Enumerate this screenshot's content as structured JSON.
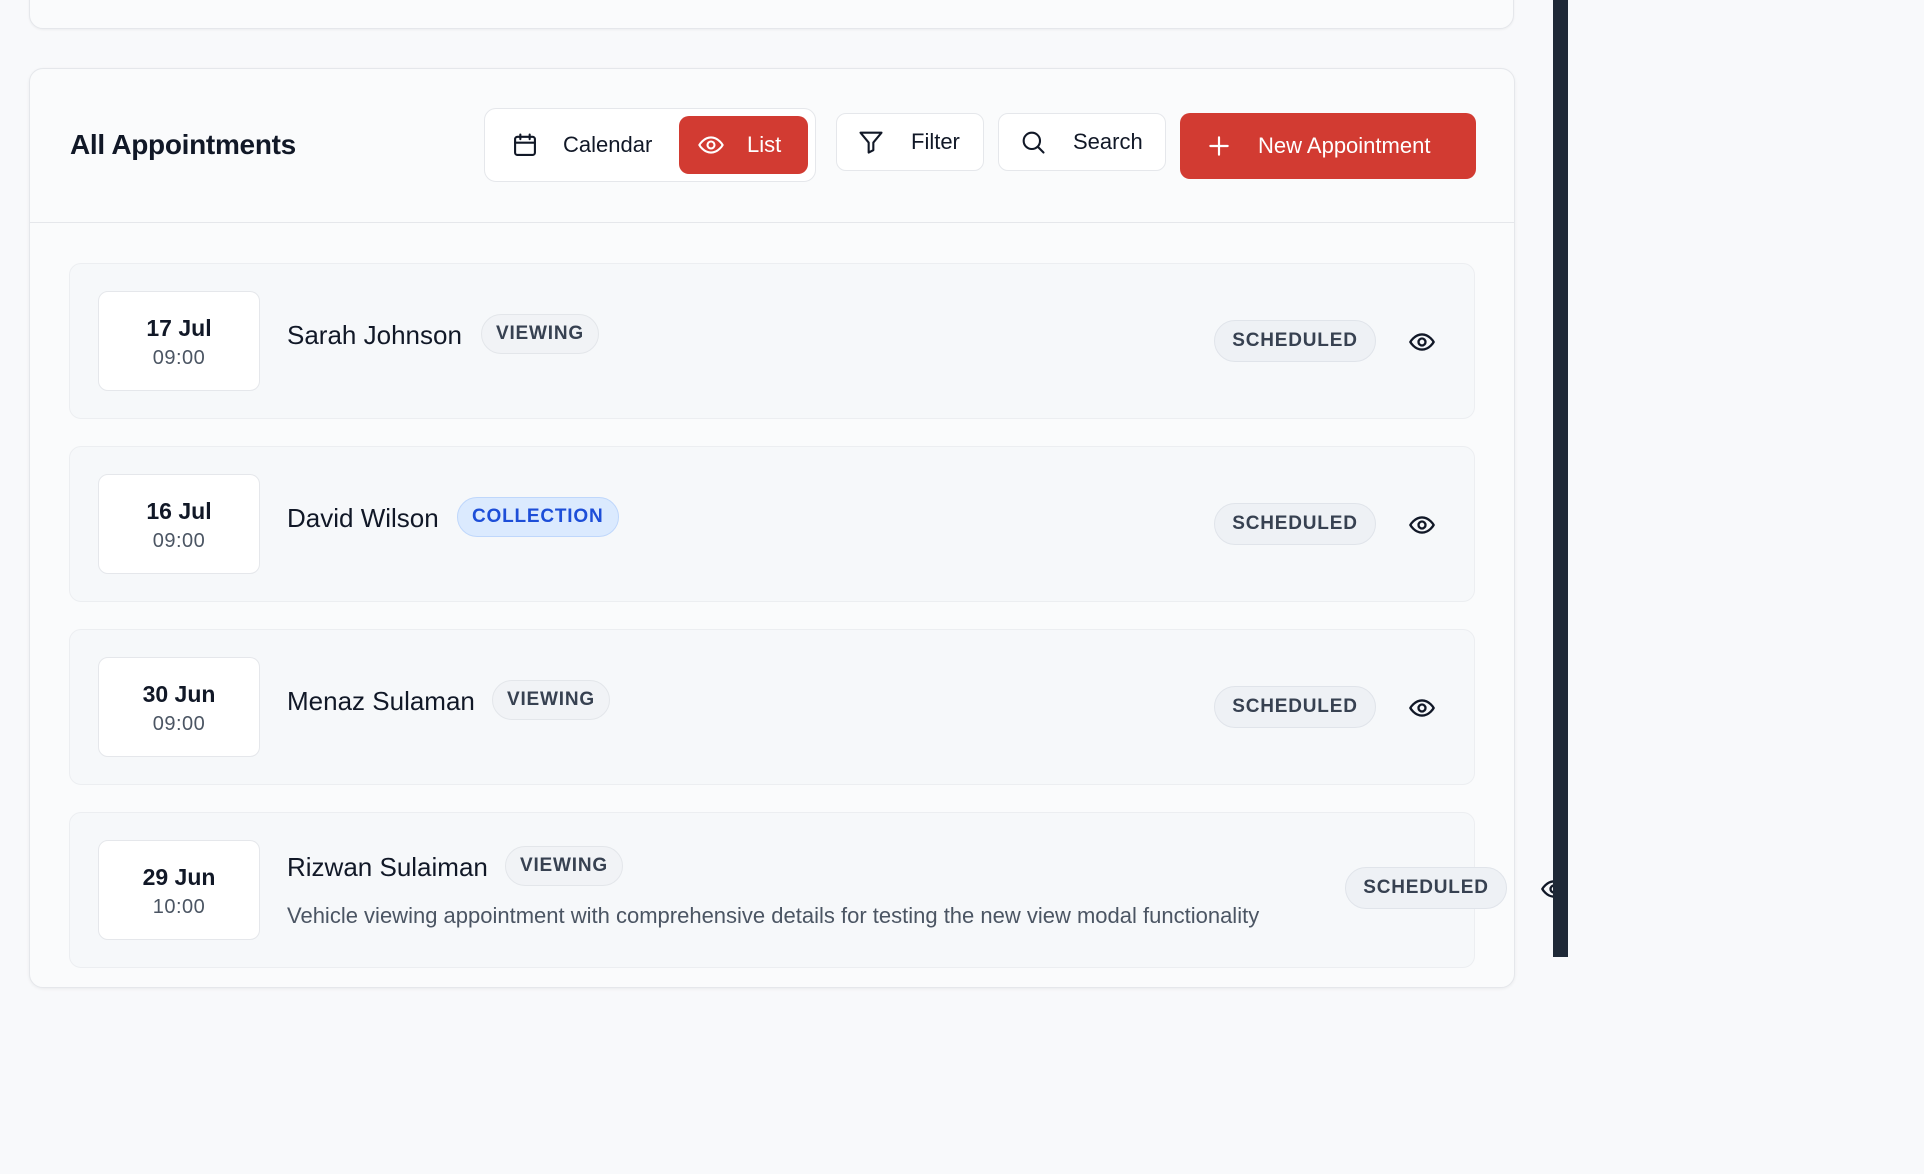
{
  "header": {
    "title": "All Appointments",
    "view_toggle": {
      "calendar_label": "Calendar",
      "list_label": "List",
      "active": "List"
    },
    "filter_label": "Filter",
    "search_label": "Search",
    "new_button_label": "New Appointment"
  },
  "colors": {
    "accent": "#d23b32",
    "collection_badge_text": "#1d4ed8",
    "collection_badge_bg": "#dbeafe"
  },
  "icons": {
    "calendar": "calendar-icon",
    "list": "eye-icon",
    "filter": "funnel-icon",
    "search": "magnifier-icon",
    "new": "plus-icon",
    "view": "eye-icon"
  },
  "appointments": [
    {
      "day": "17 Jul",
      "time": "09:00",
      "name": "Sarah Johnson",
      "type": "VIEWING",
      "status": "SCHEDULED",
      "description": ""
    },
    {
      "day": "16 Jul",
      "time": "09:00",
      "name": "David Wilson",
      "type": "COLLECTION",
      "status": "SCHEDULED",
      "description": ""
    },
    {
      "day": "30 Jun",
      "time": "09:00",
      "name": "Menaz Sulaman",
      "type": "VIEWING",
      "status": "SCHEDULED",
      "description": ""
    },
    {
      "day": "29 Jun",
      "time": "10:00",
      "name": "Rizwan Sulaiman",
      "type": "VIEWING",
      "status": "SCHEDULED",
      "description": "Vehicle viewing appointment with comprehensive details for testing the new view modal functionality"
    }
  ]
}
